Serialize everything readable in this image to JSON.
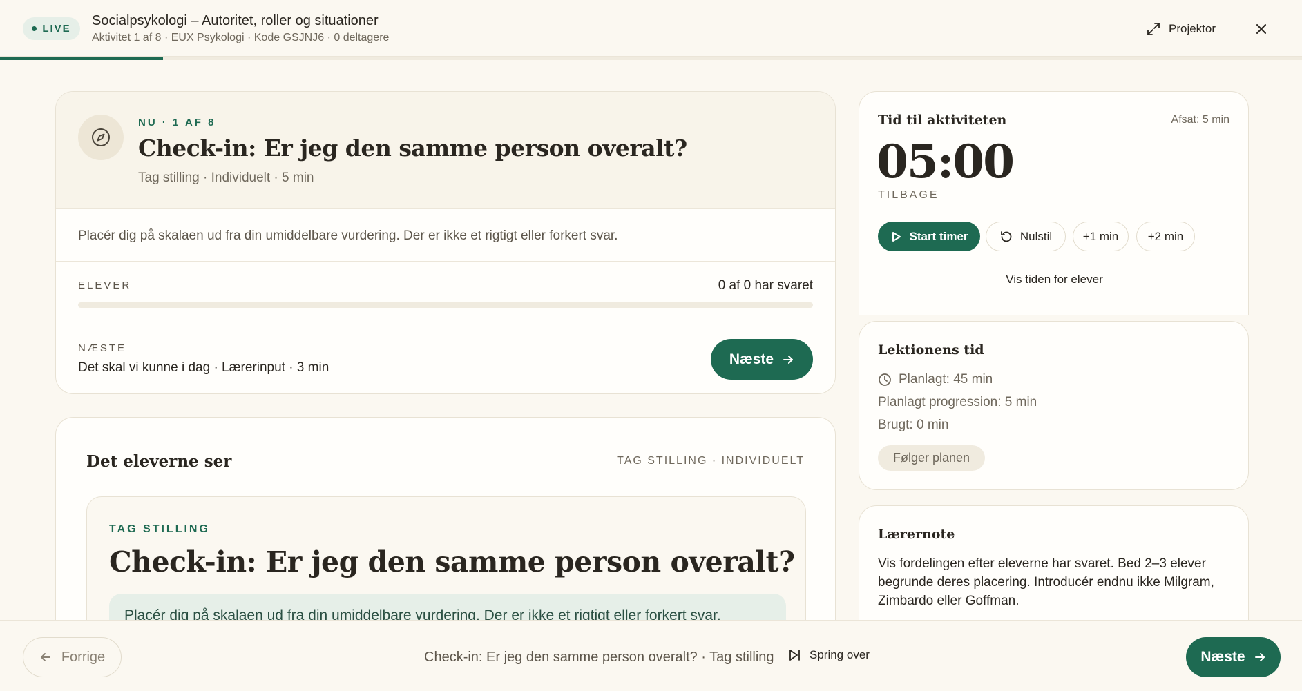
{
  "header": {
    "live_label": "LIVE",
    "title": "Socialpsykologi – Autoritet, roller og situationer",
    "subtitle": "Aktivitet 1 af 8 · EUX Psykologi · Kode GSJNJ6 · 0 deltagere",
    "projector_label": "Projektor",
    "progress_fraction": 0.125
  },
  "activity": {
    "now_label": "NU · 1 AF 8",
    "title": "Check-in: Er jeg den samme person overalt?",
    "meta": "Tag stilling · Individuelt · 5 min",
    "instruction": "Placér dig på skalaen ud fra din umiddelbare vurdering. Der er ikke et rigtigt eller forkert svar.",
    "students_label": "ELEVER",
    "answered_text": "0 af 0 har svaret",
    "answered_fraction": 0,
    "next_label": "NÆSTE",
    "next_description": "Det skal vi kunne i dag · Lærerinput · 3 min",
    "next_button": "Næste"
  },
  "student_view": {
    "title": "Det eleverne ser",
    "tag": "TAG STILLING · INDIVIDUELT",
    "preview_tag": "TAG STILLING",
    "preview_title": "Check-in: Er jeg den samme person overalt?",
    "preview_instruction": "Placér dig på skalaen ud fra din umiddelbare vurdering. Der er ikke et rigtigt eller forkert svar."
  },
  "timer": {
    "title": "Tid til aktiviteten",
    "allocated": "Afsat: 5 min",
    "time": "05:00",
    "remaining_label": "TILBAGE",
    "start_label": "Start timer",
    "reset_label": "Nulstil",
    "plus1_label": "+1 min",
    "plus2_label": "+2 min",
    "show_students_label": "Vis tiden for elever"
  },
  "lesson": {
    "title": "Lektionens tid",
    "planned": "Planlagt: 45 min",
    "planned_progression": "Planlagt progression: 5 min",
    "used": "Brugt: 0 min",
    "status": "Følger planen"
  },
  "teacher_note": {
    "title": "Lærernote",
    "text": "Vis fordelingen efter eleverne har svaret. Bed 2–3 elever begrunde deres placering. Introducér endnu ikke Milgram, Zimbardo eller Goffman."
  },
  "footer": {
    "prev_label": "Forrige",
    "center_text": "Check-in: Er jeg den samme person overalt? · Tag stilling",
    "skip_label": "Spring over",
    "next_label": "Næste"
  },
  "colors": {
    "accent": "#1e6a52",
    "background": "#fbf8f1",
    "card": "#fffefb"
  }
}
